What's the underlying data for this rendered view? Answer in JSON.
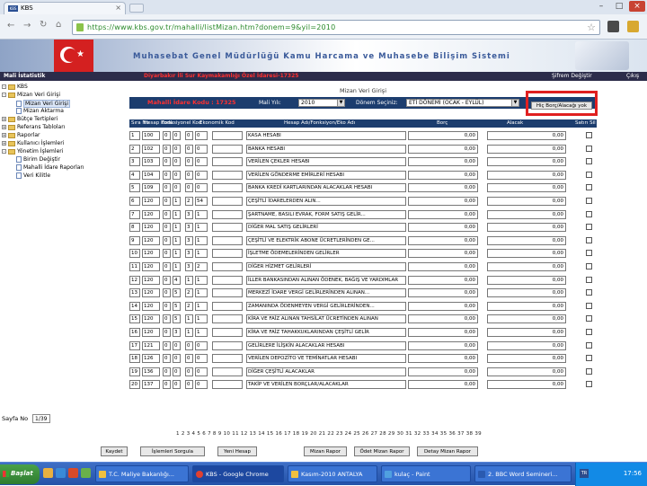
{
  "browser": {
    "tab_title": "KBS",
    "tab_favicon": "KBS",
    "url": "https://www.kbs.gov.tr/mahalli/listMizan.htm?donem=9&yil=2010"
  },
  "app": {
    "banner_title": "Muhasebat Genel Müdürlüğü Kamu Harcama ve Muhasebe Bilişim Sistemi",
    "left_label": "Mali İstatistik",
    "center_label": "Diyarbakır İli Sur Kaymakamlığı Özel İdaresi-17325",
    "right_label_1": "Şifrem Değiştir",
    "right_label_2": "Çıkış"
  },
  "sidebar": {
    "items": [
      {
        "label": "KBS",
        "kind": "root"
      },
      {
        "label": "Mizan Veri Girişi",
        "kind": "folder-open"
      },
      {
        "label": "Mizan Veri Girişi",
        "kind": "doc",
        "selected": true
      },
      {
        "label": "Mizan Aktarma",
        "kind": "doc"
      },
      {
        "label": "Bütçe Tertipleri",
        "kind": "folder"
      },
      {
        "label": "Referans Tabloları",
        "kind": "folder"
      },
      {
        "label": "Raporlar",
        "kind": "folder"
      },
      {
        "label": "Kullanıcı İşlemleri",
        "kind": "folder"
      },
      {
        "label": "Yönetim İşlemleri",
        "kind": "folder-open"
      },
      {
        "label": "Birim Değiştir",
        "kind": "doc"
      },
      {
        "label": "Mahalli İdare Raporları",
        "kind": "doc"
      },
      {
        "label": "Veri Kilitle",
        "kind": "doc"
      }
    ]
  },
  "main": {
    "section_label": "Mizan Veri Girişi",
    "filter": {
      "code_label": "Mahalli İdare Kodu : 17325",
      "year_label": "Mali Yılı:",
      "year_value": "2010",
      "period_label": "Dönem Seçiniz:",
      "period_value": "ETİ DÖNEMİ (OCAK - EYLÜL)"
    },
    "highlight_button": "Hiç Borç/Alacağı yok",
    "columns": [
      "Sıra No",
      "Hesap Kodu",
      "Fonksiyonel Kod",
      "Ekonomik Kod",
      "Hesap Adı/Fonksiyon/Eko Adı",
      "Borç",
      "Alacak",
      "Satırı Sil"
    ],
    "rows": [
      {
        "no": "1",
        "hk": "100",
        "f1": "0",
        "f2": "0",
        "e1": "0",
        "e2": "0",
        "name": "KASA HESABI",
        "borc": "0,00",
        "alacak": "0,00"
      },
      {
        "no": "2",
        "hk": "102",
        "f1": "0",
        "f2": "0",
        "e1": "0",
        "e2": "0",
        "name": "BANKA HESABI",
        "borc": "0,00",
        "alacak": "0,00"
      },
      {
        "no": "3",
        "hk": "103",
        "f1": "0",
        "f2": "0",
        "e1": "0",
        "e2": "0",
        "name": "VERİLEN ÇEKLER HESABI",
        "borc": "0,00",
        "alacak": "0,00"
      },
      {
        "no": "4",
        "hk": "104",
        "f1": "0",
        "f2": "0",
        "e1": "0",
        "e2": "0",
        "name": "VERİLEN GÖNDERME EMİRLERİ HESABI",
        "borc": "0,00",
        "alacak": "0,00"
      },
      {
        "no": "5",
        "hk": "109",
        "f1": "0",
        "f2": "0",
        "e1": "0",
        "e2": "0",
        "name": "BANKA KREDİ KARTLARINDAN ALACAKLAR HESABI",
        "borc": "0,00",
        "alacak": "0,00"
      },
      {
        "no": "6",
        "hk": "120",
        "f1": "0",
        "f2": "1",
        "e1": "2",
        "e2": "54",
        "name": "ÇEŞİTLİ İDARELERDEN ALIN...",
        "borc": "0,00",
        "alacak": "0,00"
      },
      {
        "no": "7",
        "hk": "120",
        "f1": "0",
        "f2": "1",
        "e1": "3",
        "e2": "1",
        "name": "ŞARTNAME, BASILI EVRAK, FORM SATIŞ GELİR...",
        "borc": "0,00",
        "alacak": "0,00"
      },
      {
        "no": "8",
        "hk": "120",
        "f1": "0",
        "f2": "1",
        "e1": "3",
        "e2": "1",
        "name": "DİĞER MAL SATIŞ GELİRLERİ",
        "borc": "0,00",
        "alacak": "0,00"
      },
      {
        "no": "9",
        "hk": "120",
        "f1": "0",
        "f2": "1",
        "e1": "3",
        "e2": "1",
        "name": "ÇEŞİTLİ VE ELEKTRİK ABONE ÜCRETLERİNDEN GE...",
        "borc": "0,00",
        "alacak": "0,00"
      },
      {
        "no": "10",
        "hk": "120",
        "f1": "0",
        "f2": "1",
        "e1": "3",
        "e2": "1",
        "name": "İŞLETME ÖDEMELERİNDEN GELİRLER",
        "borc": "0,00",
        "alacak": "0,00"
      },
      {
        "no": "11",
        "hk": "120",
        "f1": "0",
        "f2": "1",
        "e1": "3",
        "e2": "2",
        "name": "DİĞER HİZMET GELİRLERİ",
        "borc": "0,00",
        "alacak": "0,00"
      },
      {
        "no": "12",
        "hk": "120",
        "f1": "0",
        "f2": "4",
        "e1": "1",
        "e2": "1",
        "name": "İLLER BANKASINDAN ALINAN ÖDENEK, BAĞIŞ VE YARDIMLAR",
        "borc": "0,00",
        "alacak": "0,00"
      },
      {
        "no": "13",
        "hk": "120",
        "f1": "0",
        "f2": "5",
        "e1": "2",
        "e2": "1",
        "name": "MERKEZİ İDARE VERGİ GELİRLERİNDEN ALINAN...",
        "borc": "0,00",
        "alacak": "0,00"
      },
      {
        "no": "14",
        "hk": "120",
        "f1": "0",
        "f2": "5",
        "e1": "2",
        "e2": "1",
        "name": "ZAMANINDA ÖDENMEYEN VERGİ GELİRLERİNDEN...",
        "borc": "0,00",
        "alacak": "0,00"
      },
      {
        "no": "15",
        "hk": "120",
        "f1": "0",
        "f2": "5",
        "e1": "1",
        "e2": "1",
        "name": "KİRA VE FAİZ ALINAN TAHSİLAT ÜCRETİNDEN ALINAN",
        "borc": "0,00",
        "alacak": "0,00"
      },
      {
        "no": "16",
        "hk": "120",
        "f1": "0",
        "f2": "3",
        "e1": "1",
        "e2": "1",
        "name": "KİRA VE FAİZ TAHAKKUKLARINDAN ÇEŞİTLİ GELİR",
        "borc": "0,00",
        "alacak": "0,00"
      },
      {
        "no": "17",
        "hk": "121",
        "f1": "0",
        "f2": "0",
        "e1": "0",
        "e2": "0",
        "name": "GELİRLERE İLİŞKİN ALACAKLAR HESABI",
        "borc": "0,00",
        "alacak": "0,00"
      },
      {
        "no": "18",
        "hk": "126",
        "f1": "0",
        "f2": "0",
        "e1": "0",
        "e2": "0",
        "name": "VERİLEN DEPOZİTO VE TEMİNATLAR HESABI",
        "borc": "0,00",
        "alacak": "0,00"
      },
      {
        "no": "19",
        "hk": "136",
        "f1": "0",
        "f2": "0",
        "e1": "0",
        "e2": "0",
        "name": "DİĞER ÇEŞİTLİ ALACAKLAR",
        "borc": "0,00",
        "alacak": "0,00"
      },
      {
        "no": "20",
        "hk": "137",
        "f1": "0",
        "f2": "0",
        "e1": "0",
        "e2": "0",
        "name": "TAKİP VE VERİLEN BORÇLAR/ALACAKLAR",
        "borc": "0,00",
        "alacak": "0,00"
      }
    ],
    "page_label": "Sayfa No",
    "page_value": "1/39",
    "page_numbers": "1 2 3 4 5 6 7 8 9 10 11 12 13 14 15 16 17 18 19 20 21 22 23 24 25 26 27 28 29 30 31 32 33 34 35 36 37 38 39",
    "buttons": [
      "Kaydet",
      "İşlemleri Sorgula",
      "Yeni Hesap",
      "Mizan Rapor",
      "Ödet Mizan Rapor",
      "Detay Mizan Rapor"
    ]
  },
  "taskbar": {
    "start": "Başlat",
    "tasks": [
      "T.C. Maliye Bakanlığı...",
      "KBS - Google Chrome",
      "Kasım-2010 ANTALYA",
      "kulaç - Paint",
      "2. BBC Word Semineri..."
    ],
    "tray_label": "TR",
    "clock": "17:56"
  }
}
